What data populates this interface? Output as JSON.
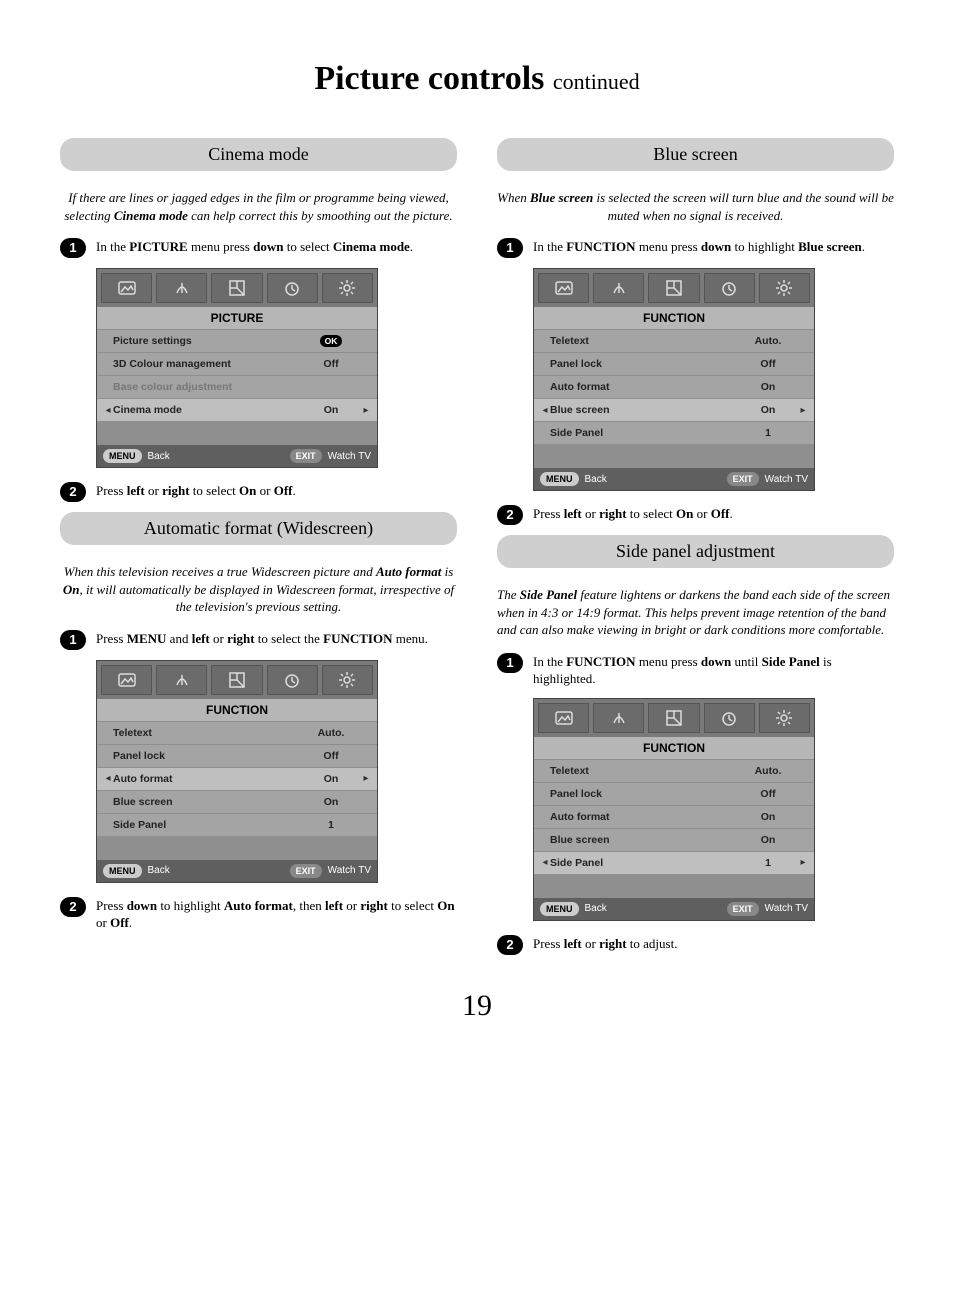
{
  "page_title_main": "Picture controls",
  "page_title_sub": "continued",
  "page_number": "19",
  "sections": {
    "cinema": {
      "header": "Cinema mode",
      "intro_pre": "If there are lines or jagged edges in the film or programme being viewed, selecting ",
      "intro_bold": "Cinema mode",
      "intro_post": " can help correct this by smoothing out the picture.",
      "step1_pre": "In the ",
      "step1_b1": "PICTURE",
      "step1_mid": " menu press ",
      "step1_b2": "down",
      "step1_mid2": " to select ",
      "step1_b3": "Cinema mode",
      "step1_end": ".",
      "step2_pre": "Press ",
      "step2_b1": "left",
      "step2_mid": " or ",
      "step2_b2": "right",
      "step2_mid2": " to select ",
      "step2_b3": "On",
      "step2_mid3": " or ",
      "step2_b4": "Off",
      "step2_end": "."
    },
    "autofmt": {
      "header": "Automatic format (Widescreen)",
      "intro_pre": "When this television receives a true Widescreen picture and ",
      "intro_b1": "Auto format",
      "intro_mid": " is ",
      "intro_b2": "On",
      "intro_post": ", it will automatically be displayed in Widescreen format, irrespective of the television's previous setting.",
      "step1_pre": "Press ",
      "step1_b1": "MENU",
      "step1_mid": " and ",
      "step1_b2": "left",
      "step1_mid2": " or ",
      "step1_b3": "right",
      "step1_mid3": " to select the ",
      "step1_b4": "FUNCTION",
      "step1_end": " menu.",
      "step2_pre": "Press ",
      "step2_b1": "down",
      "step2_mid": " to highlight ",
      "step2_b2": "Auto format",
      "step2_mid2": ", then ",
      "step2_b3": "left",
      "step2_mid3": " or ",
      "step2_b4": "right",
      "step2_mid4": " to select ",
      "step2_b5": "On",
      "step2_mid5": " or ",
      "step2_b6": "Off",
      "step2_end": "."
    },
    "blue": {
      "header": "Blue screen",
      "intro_pre": "When ",
      "intro_b1": "Blue screen",
      "intro_post": " is selected the screen will turn blue and the sound will be muted when no signal is received.",
      "step1_pre": "In the ",
      "step1_b1": "FUNCTION",
      "step1_mid": " menu press ",
      "step1_b2": "down",
      "step1_mid2": " to highlight ",
      "step1_b3": "Blue screen",
      "step1_end": ".",
      "step2_pre": "Press ",
      "step2_b1": "left",
      "step2_mid": " or ",
      "step2_b2": "right",
      "step2_mid2": " to select ",
      "step2_b3": "On",
      "step2_mid3": " or ",
      "step2_b4": "Off",
      "step2_end": "."
    },
    "sidepanel": {
      "header": "Side panel adjustment",
      "intro_pre": "The ",
      "intro_b1": "Side Panel",
      "intro_post": " feature lightens or darkens the band each side of the screen when in 4:3 or 14:9 format. This helps prevent image retention of the band and can also make viewing in bright or dark conditions more comfortable.",
      "step1_pre": "In the ",
      "step1_b1": "FUNCTION",
      "step1_mid": " menu press ",
      "step1_b2": "down",
      "step1_mid2": " until ",
      "step1_b3": "Side Panel",
      "step1_end": " is highlighted.",
      "step2_pre": "Press ",
      "step2_b1": "left",
      "step2_mid": " or ",
      "step2_b2": "right",
      "step2_end": " to adjust."
    }
  },
  "osd_common": {
    "menu_pill": "MENU",
    "exit_pill": "EXIT",
    "back_label": "Back",
    "watch_label": "Watch TV"
  },
  "osd_picture": {
    "title": "PICTURE",
    "rows": [
      {
        "label": "Picture settings",
        "val_ok": true
      },
      {
        "label": "3D Colour management",
        "val": "Off"
      },
      {
        "label": "Base colour adjustment",
        "disabled": true
      },
      {
        "label": "Cinema mode",
        "val": "On",
        "selected": true
      }
    ]
  },
  "osd_function": {
    "title": "FUNCTION",
    "rows": [
      {
        "label": "Teletext",
        "val": "Auto."
      },
      {
        "label": "Panel lock",
        "val": "Off"
      },
      {
        "label": "Auto format",
        "val": "On"
      },
      {
        "label": "Blue screen",
        "val": "On"
      },
      {
        "label": "Side Panel",
        "val": "1"
      }
    ],
    "selected_autofmt": 2,
    "selected_blue": 3,
    "selected_side": 4
  }
}
